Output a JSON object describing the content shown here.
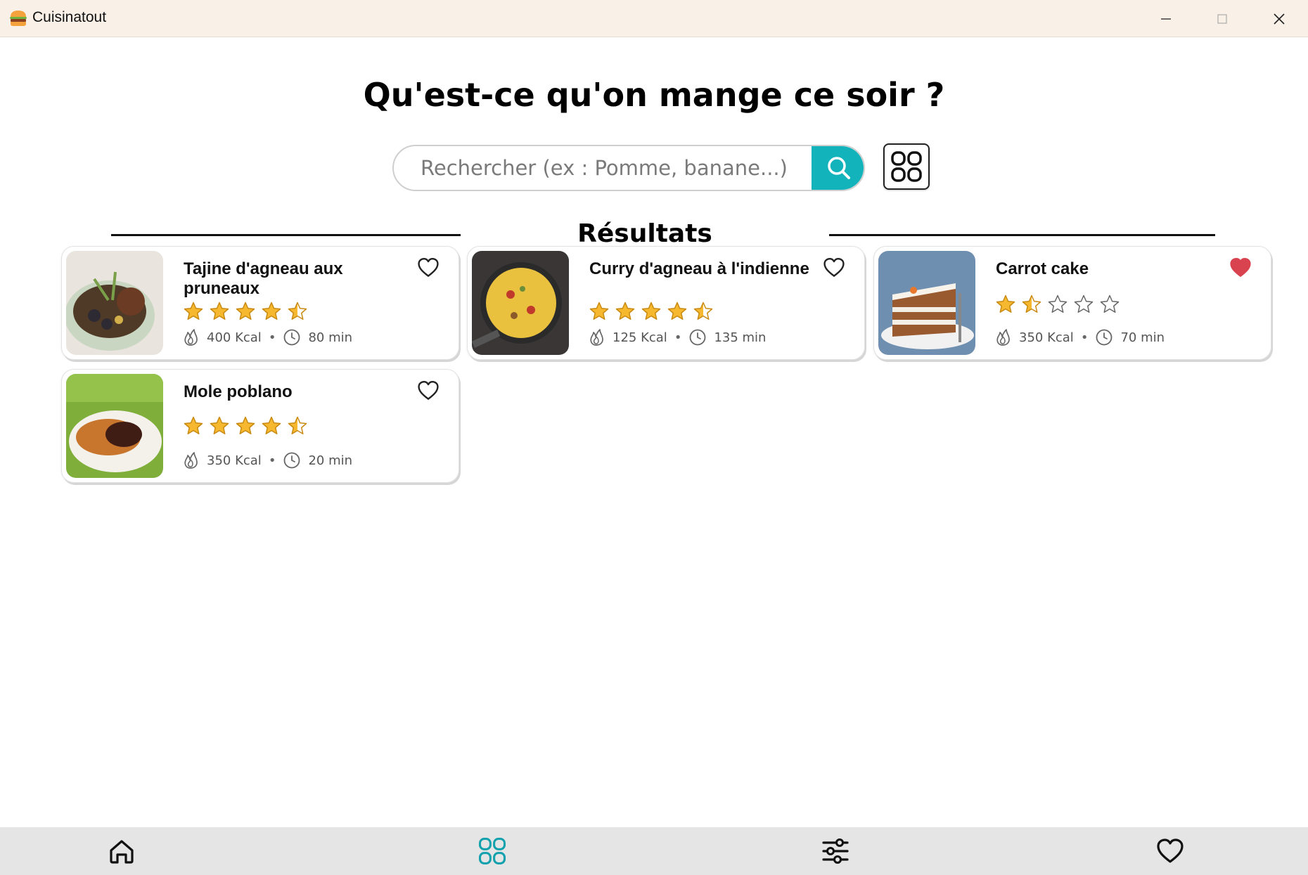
{
  "window": {
    "title": "Cuisinatout",
    "app_icon": "burger-icon",
    "controls": [
      "minimize-icon",
      "maximize-icon",
      "close-icon"
    ]
  },
  "header": {
    "headline": "Qu'est-ce qu'on mange ce soir ?"
  },
  "search": {
    "placeholder": "Rechercher (ex : Pomme, banane...)",
    "value": "",
    "button_icon": "search-icon",
    "view_toggle_icon": "grid-icon",
    "accent_color": "#13b3bc"
  },
  "results": {
    "section_title": "Résultats",
    "recipes": [
      {
        "title": "Tajine d'agneau aux pruneaux",
        "rating": 4.5,
        "calories": "400 Kcal",
        "duration": "80 min",
        "favorite": false
      },
      {
        "title": "Curry d'agneau à l'indienne",
        "rating": 4.5,
        "calories": "125 Kcal",
        "duration": "135 min",
        "favorite": false
      },
      {
        "title": "Carrot cake",
        "rating": 1.5,
        "calories": "350 Kcal",
        "duration": "70 min",
        "favorite": true
      },
      {
        "title": "Mole poblano",
        "rating": 4.5,
        "calories": "350 Kcal",
        "duration": "20 min",
        "favorite": false
      }
    ],
    "separator": "•"
  },
  "bottom_nav": {
    "items": [
      {
        "icon": "home-icon",
        "active": false
      },
      {
        "icon": "grid-icon",
        "active": true
      },
      {
        "icon": "filters-icon",
        "active": false
      },
      {
        "icon": "heart-icon",
        "active": false
      }
    ],
    "active_color": "#13a2ad"
  },
  "colors": {
    "star": "#f5b82e",
    "favorite_heart": "#d9434f",
    "titlebar_bg": "#f9f1e8"
  }
}
